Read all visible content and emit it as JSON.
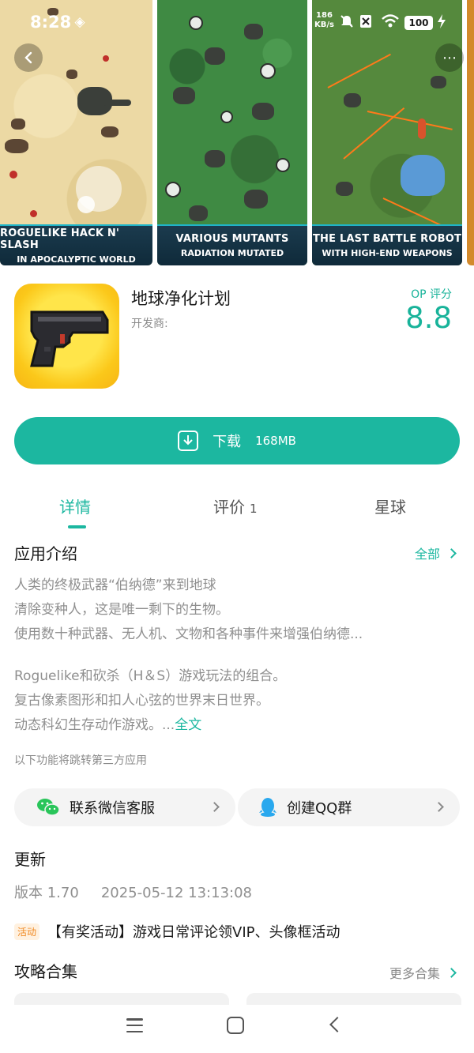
{
  "status_bar": {
    "time": "8:28",
    "net_speed": "186",
    "net_unit": "KB/s",
    "battery": "100"
  },
  "screenshots": [
    {
      "line1": "ROGUELIKE HACK N' SLASH",
      "line2": "IN APOCALYPTIC WORLD"
    },
    {
      "line1": "VARIOUS MUTANTS",
      "line2": "RADIATION MUTATED"
    },
    {
      "line1": "THE LAST BATTLE ROBOT",
      "line2": "WITH HIGH-END WEAPONS"
    }
  ],
  "app": {
    "title": "地球净化计划",
    "developer_label": "开发商:",
    "rating_label": "OP 评分",
    "rating_value": "8.8"
  },
  "download": {
    "label": "下载",
    "size": "168MB"
  },
  "tabs": [
    {
      "label": "详情",
      "active": true
    },
    {
      "label": "评价",
      "count": "1"
    },
    {
      "label": "星球"
    }
  ],
  "intro": {
    "title": "应用介绍",
    "link": "全部",
    "paragraph1": [
      "人类的终极武器“伯纳德”来到地球",
      "清除变种人，这是唯一剩下的生物。",
      "使用数十种武器、无人机、文物和各种事件来增强伯纳德..."
    ],
    "paragraph2": [
      "Roguelike和砍杀（H＆S）游戏玩法的组合。",
      "复古像素图形和扣人心弦的世界末日世界。",
      "动态科幻生存动作游戏。..."
    ],
    "full_text_link": "全文",
    "third_party_note": "以下功能将跳转第三方应用"
  },
  "contacts": [
    {
      "label": "联系微信客服",
      "icon": "wechat-icon"
    },
    {
      "label": "创建QQ群",
      "icon": "qq-icon"
    }
  ],
  "update": {
    "title": "更新",
    "version": "版本 1.70",
    "date": "2025-05-12 13:13:08",
    "badge": "活动",
    "activity": "【有奖活动】游戏日常评论领VIP、头像框活动"
  },
  "guides": {
    "title": "攻略合集",
    "link": "更多合集"
  },
  "colors": {
    "accent": "#1cb7a0",
    "badge": "#f08a24"
  }
}
